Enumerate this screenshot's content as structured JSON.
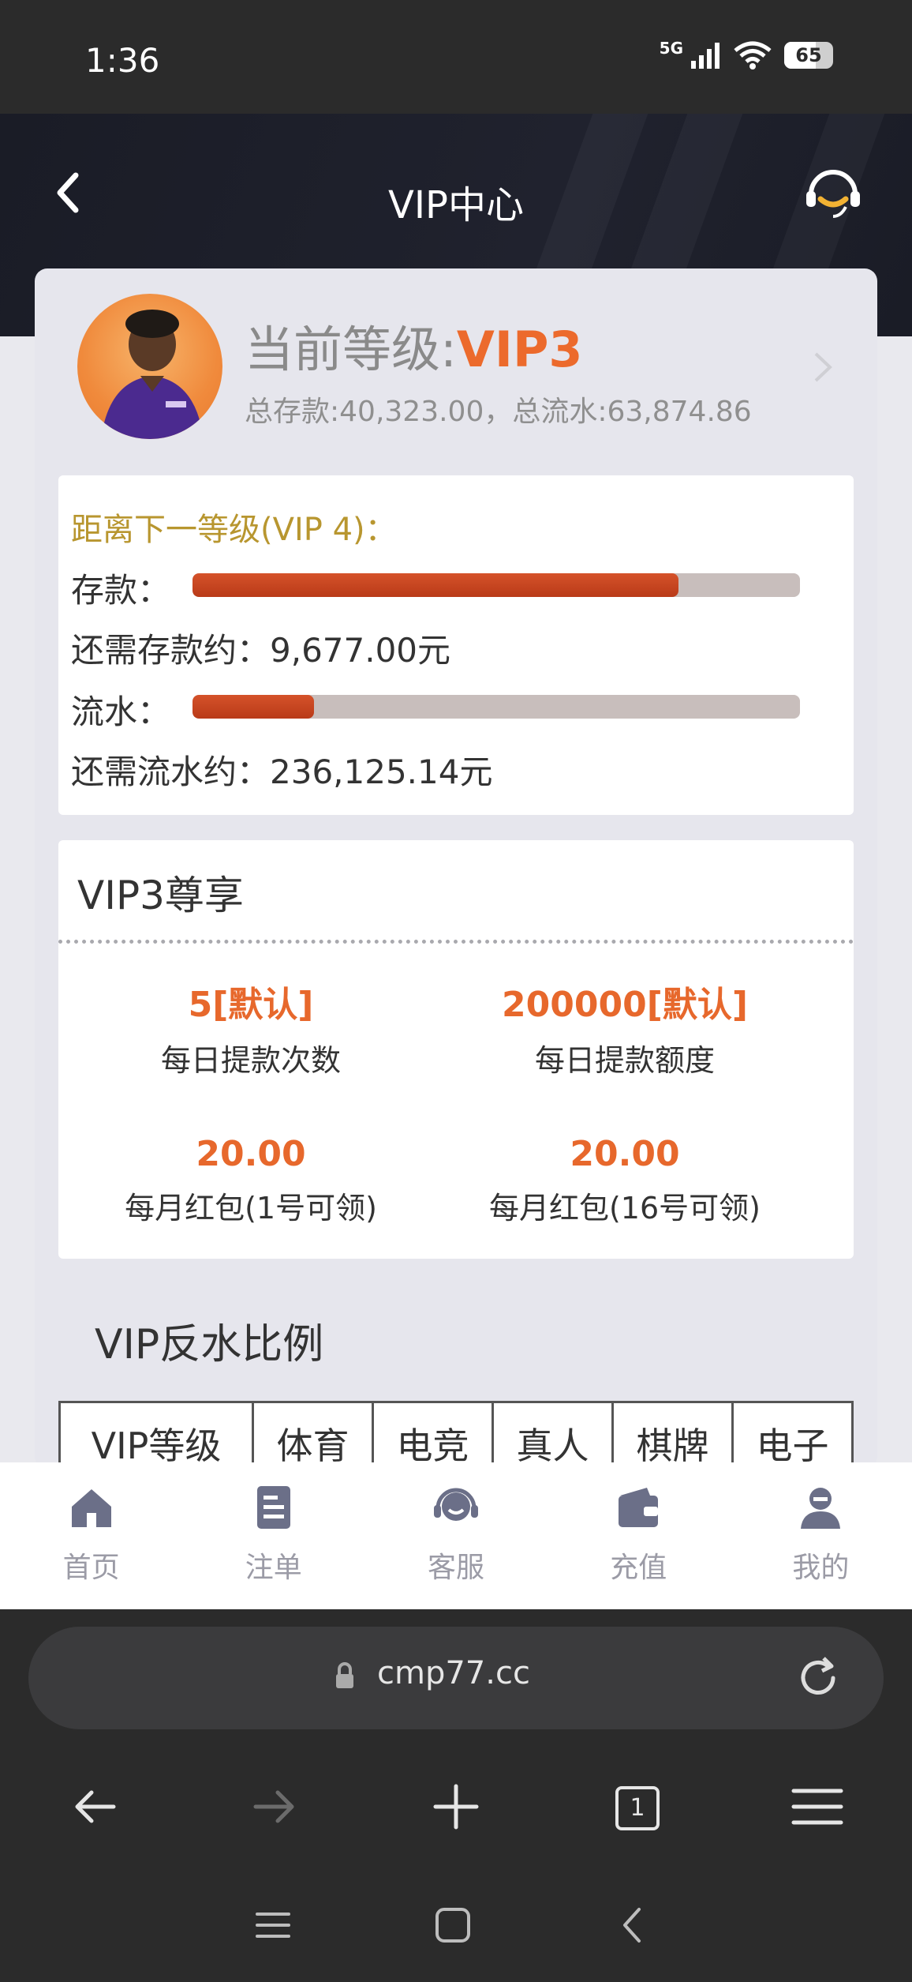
{
  "status_bar": {
    "time": "1:36",
    "network": "5G",
    "battery": "65"
  },
  "header": {
    "title": "VIP中心"
  },
  "profile": {
    "level_prefix": "当前等级:",
    "level": "VIP3",
    "totals": "总存款:40,323.00，总流水:63,874.86"
  },
  "progress": {
    "heading": "距离下一等级(VIP 4)：",
    "deposit_label": "存款：",
    "deposit_fraction": 0.8,
    "deposit_remaining": "还需存款约：9,677.00元",
    "turnover_label": "流水：",
    "turnover_fraction": 0.2,
    "turnover_remaining": "还需流水约：236,125.14元"
  },
  "benefits": {
    "title": "VIP3尊享",
    "items": [
      {
        "value": "5[默认]",
        "label": "每日提款次数"
      },
      {
        "value": "200000[默认]",
        "label": "每日提款额度"
      },
      {
        "value": "20.00",
        "label": "每月红包(1号可领)"
      },
      {
        "value": "20.00",
        "label": "每月红包(16号可领)"
      }
    ]
  },
  "rebate": {
    "title": "VIP反水比例",
    "headers": [
      "VIP等级",
      "体育",
      "电竞",
      "真人",
      "棋牌",
      "电子"
    ]
  },
  "tabbar": {
    "items": [
      {
        "label": "首页",
        "icon": "home-icon"
      },
      {
        "label": "注单",
        "icon": "order-icon"
      },
      {
        "label": "客服",
        "icon": "headset-icon"
      },
      {
        "label": "充值",
        "icon": "wallet-icon"
      },
      {
        "label": "我的",
        "icon": "user-icon"
      }
    ]
  },
  "browser": {
    "url": "cmp77.cc",
    "tab_count": "1"
  },
  "colors": {
    "accent": "#ec6a2c",
    "gold": "#b8962f",
    "bar": "#c8401c",
    "header_bg": "#1a1c26"
  }
}
